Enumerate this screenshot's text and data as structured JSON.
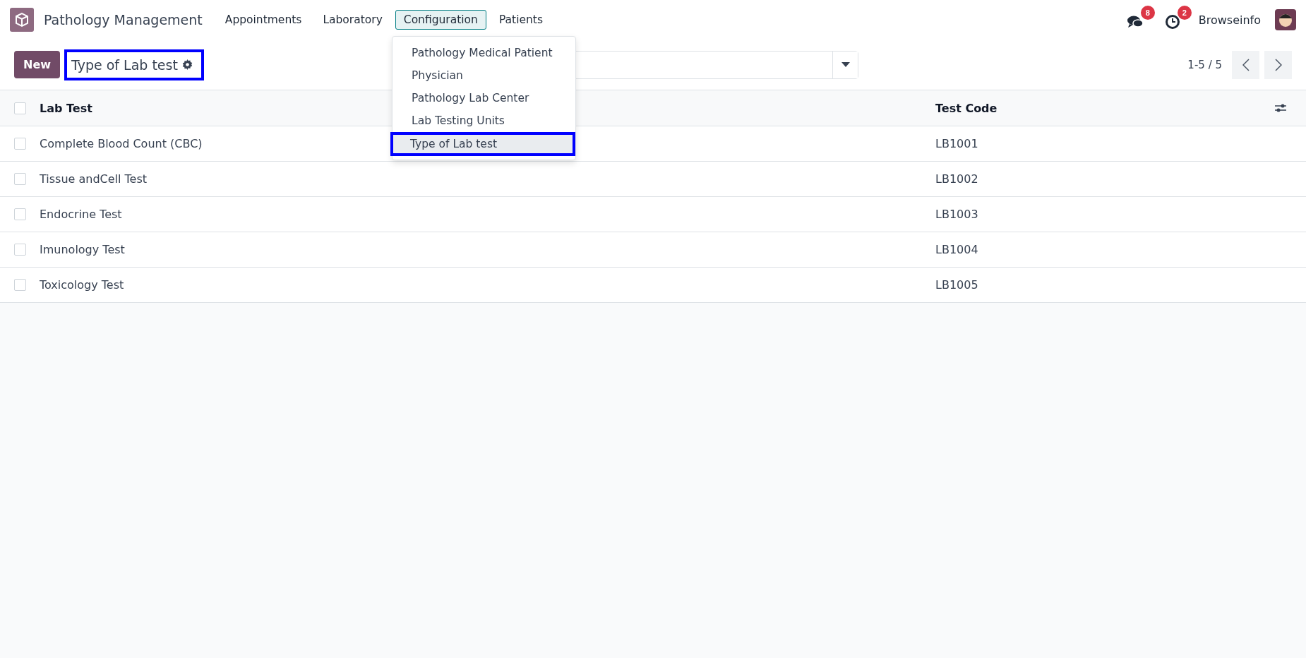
{
  "app": {
    "title": "Pathology Management"
  },
  "menu": [
    {
      "label": "Appointments",
      "selected": false
    },
    {
      "label": "Laboratory",
      "selected": false
    },
    {
      "label": "Configuration",
      "selected": true
    },
    {
      "label": "Patients",
      "selected": false
    }
  ],
  "dropdown": [
    {
      "label": "Pathology Medical Patient",
      "highlighted": false
    },
    {
      "label": "Physician",
      "highlighted": false
    },
    {
      "label": "Pathology Lab Center",
      "highlighted": false
    },
    {
      "label": "Lab Testing Units",
      "highlighted": false
    },
    {
      "label": "Type of Lab test",
      "highlighted": true
    }
  ],
  "systray": {
    "messages_count": "8",
    "activities_count": "2",
    "user": "Browseinfo"
  },
  "control_panel": {
    "new_button": "New",
    "title": "Type of Lab test",
    "title_highlighted": true,
    "pager": "1-5 / 5"
  },
  "table": {
    "all_checked": false,
    "columns": [
      "Lab Test",
      "Test Code"
    ],
    "rows": [
      {
        "lab_test": "Complete Blood Count (CBC)",
        "test_code": "LB1001",
        "checked": false
      },
      {
        "lab_test": "Tissue andCell Test",
        "test_code": "LB1002",
        "checked": false
      },
      {
        "lab_test": "Endocrine Test",
        "test_code": "LB1003",
        "checked": false
      },
      {
        "lab_test": "Imunology Test",
        "test_code": "LB1004",
        "checked": false
      },
      {
        "lab_test": "Toxicology Test",
        "test_code": "LB1005",
        "checked": false
      }
    ]
  }
}
